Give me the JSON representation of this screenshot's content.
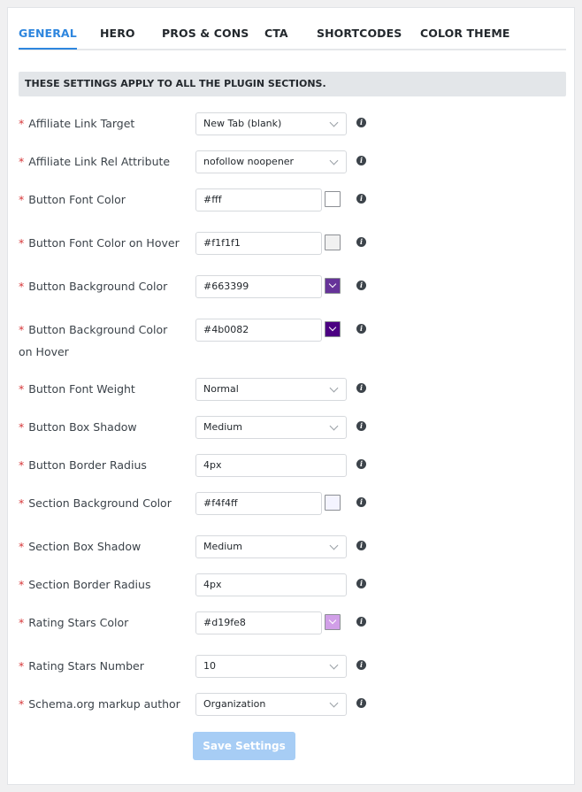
{
  "tabs": [
    {
      "label": "GENERAL",
      "active": true
    },
    {
      "label": "HERO"
    },
    {
      "label": "PROS & CONS"
    },
    {
      "label": "CTA"
    },
    {
      "label": "SHORTCODES"
    },
    {
      "label": "COLOR THEME"
    }
  ],
  "notice": "THESE SETTINGS APPLY TO ALL THE PLUGIN SECTIONS.",
  "required_mark": "*",
  "info_icon": "info-icon",
  "fields": [
    {
      "label": "Affiliate Link Target",
      "type": "select",
      "value": "New Tab (blank)"
    },
    {
      "label": "Affiliate Link Rel Attribute",
      "type": "select",
      "value": "nofollow noopener"
    },
    {
      "label": "Button Font Color",
      "type": "color",
      "value": "#fff",
      "swatch": "#ffffff"
    },
    {
      "label": "Button Font Color on Hover",
      "type": "color",
      "value": "#f1f1f1",
      "swatch": "#f1f1f1"
    },
    {
      "label": "Button Background Color",
      "type": "color",
      "value": "#663399",
      "swatch": "#663399"
    },
    {
      "label": "Button Background Color on Hover",
      "type": "color",
      "value": "#4b0082",
      "swatch": "#4b0082"
    },
    {
      "label": "Button Font Weight",
      "type": "select",
      "value": "Normal"
    },
    {
      "label": "Button Box Shadow",
      "type": "select",
      "value": "Medium"
    },
    {
      "label": "Button Border Radius",
      "type": "text",
      "value": "4px"
    },
    {
      "label": "Section Background Color",
      "type": "color",
      "value": "#f4f4ff",
      "swatch": "#f4f4ff"
    },
    {
      "label": "Section Box Shadow",
      "type": "select",
      "value": "Medium"
    },
    {
      "label": "Section Border Radius",
      "type": "text",
      "value": "4px"
    },
    {
      "label": "Rating Stars Color",
      "type": "color",
      "value": "#d19fe8",
      "swatch": "#d19fe8"
    },
    {
      "label": "Rating Stars Number",
      "type": "select",
      "value": "10"
    },
    {
      "label": "Schema.org markup author",
      "type": "select",
      "value": "Organization"
    }
  ],
  "save_label": "Save Settings",
  "colors": {
    "accent": "#2e86de",
    "required": "#d63638",
    "save_button": "#a7cdf5"
  }
}
